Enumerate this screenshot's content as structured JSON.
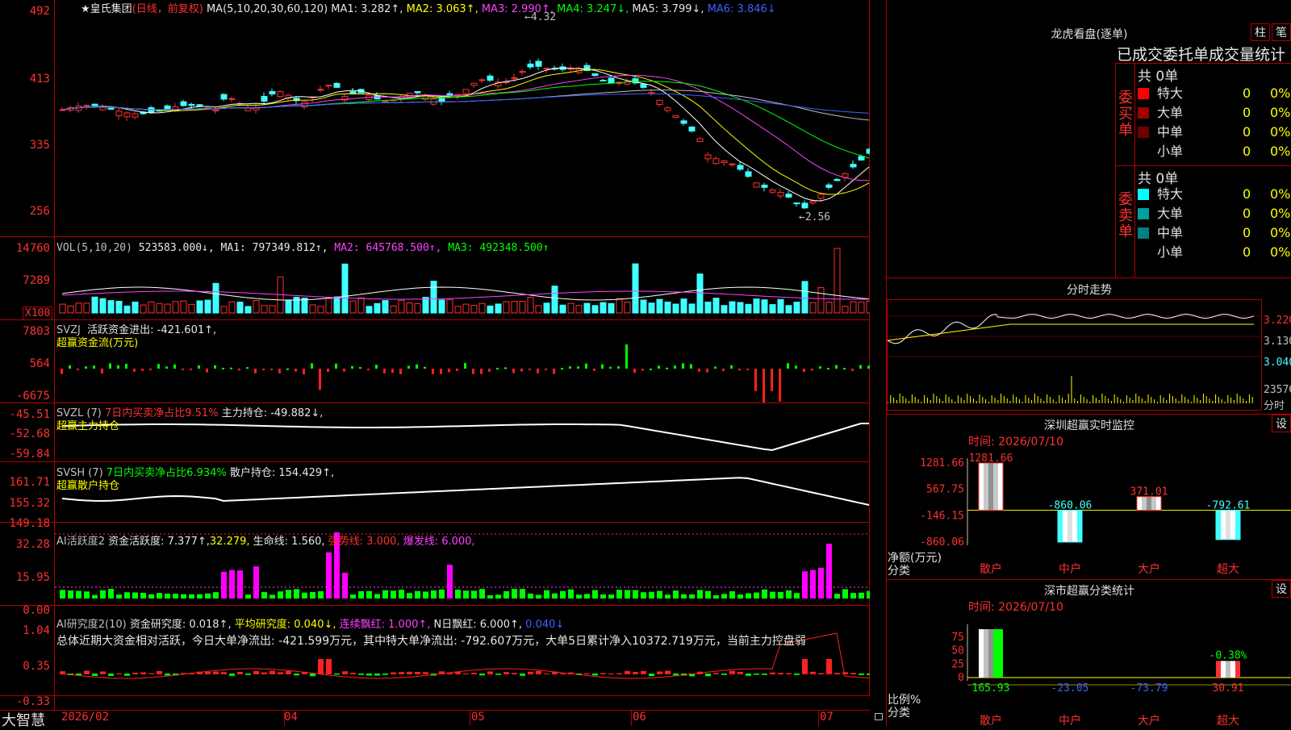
{
  "main": {
    "header": {
      "star": "★",
      "stock_name": "皇氏集团",
      "period": "(日线，前复权)",
      "ma_label": "MA(5,10,20,30,60,120)",
      "ma1": "MA1: 3.282↑,",
      "ma2": "MA2: 3.063↑,",
      "ma3": "MA3: 2.990↑,",
      "ma4": "MA4: 3.247↓,",
      "ma5": "MA5: 3.799↓,",
      "ma6": "MA6: 3.846↓"
    },
    "axis": [
      "492",
      "413",
      "335",
      "256"
    ],
    "high_label": "←4.32",
    "low_label": "←2.56"
  },
  "vol": {
    "header": {
      "name": "VOL(5,10,20)",
      "value": "523583.000↓,",
      "ma1": "MA1: 797349.812↑,",
      "ma2": "MA2: 645768.500↑,",
      "ma3": "MA3: 492348.500↑"
    },
    "axis": [
      "14760",
      "7289"
    ],
    "unit": "X100"
  },
  "svzj": {
    "header": {
      "name": "SVZJ",
      "line1": "活跃资金进出: -421.601↑,",
      "line2": "超赢资金流(万元)"
    },
    "axis": [
      "7803",
      "564",
      "-6675"
    ]
  },
  "svzl": {
    "header": {
      "name": "SVZL (7)",
      "ratio": "7日内买卖净占比9.51%",
      "value": "主力持仓: -49.882↓,",
      "line2": "超赢主力持仓"
    },
    "axis": [
      "-45.51",
      "-52.68",
      "-59.84"
    ]
  },
  "svsh": {
    "header": {
      "name": "SVSH (7)",
      "ratio": "7日内买卖净占比6.934%",
      "value": "散户持仓: 154.429↑,",
      "line2": "超赢散户持仓"
    },
    "axis": [
      "161.71",
      "155.32",
      "149.18"
    ]
  },
  "ai_active": {
    "header": {
      "name": "AI活跃度2",
      "a": "资金活跃度: 7.377↑,",
      "b": "32.279,",
      "c": "生命线: 1.560,",
      "d": "强势线: 3.000,",
      "e": "爆发线: 6.000,"
    },
    "axis": [
      "32.28",
      "15.95",
      "0.00"
    ]
  },
  "ai_research": {
    "header": {
      "name": "AI研究度2(10)",
      "a": "资金研究度: 0.018↑,",
      "b": "平均研究度: 0.040↓,",
      "c": "连续飘红: 1.000↑,",
      "d": "N日飘红: 6.000↑,",
      "e": "0.040↓"
    },
    "summary": "总体近期大资金相对活跃，今日大单净流出: -421.599万元，其中特大单净流出: -792.607万元，大单5日累计净入10372.719万元，当前主力控盘弱",
    "axis": [
      "1.04",
      "0.35",
      "-0.33"
    ]
  },
  "bottom": {
    "logo": "大智慧",
    "dates": [
      "2026/02",
      "04",
      "05",
      "06",
      "07"
    ]
  },
  "right": {
    "lhkp": {
      "title": "龙虎看盘(逐单)",
      "btn1": "柱",
      "btn2": "笔",
      "subtitle": "已成交委托单成交量统计"
    },
    "buy": {
      "label": "委买单",
      "total": "共 0单",
      "rows": [
        {
          "name": "特大",
          "count": "0",
          "pct": "0%",
          "color": "#ff0000"
        },
        {
          "name": "大单",
          "count": "0",
          "pct": "0%",
          "color": "#a00000"
        },
        {
          "name": "中单",
          "count": "0",
          "pct": "0%",
          "color": "#700000"
        },
        {
          "name": "小单",
          "count": "0",
          "pct": "0%",
          "color": "#000000"
        }
      ]
    },
    "sell": {
      "label": "委卖单",
      "total": "共 0单",
      "rows": [
        {
          "name": "特大",
          "count": "0",
          "pct": "0%",
          "color": "#00ffff"
        },
        {
          "name": "大单",
          "count": "0",
          "pct": "0%",
          "color": "#00a0a0"
        },
        {
          "name": "中单",
          "count": "0",
          "pct": "0%",
          "color": "#008080"
        },
        {
          "name": "小单",
          "count": "0",
          "pct": "0%",
          "color": "#000000"
        }
      ]
    },
    "fenshi": {
      "title": "分时走势",
      "axis": [
        "3.220",
        "3.130",
        "3.040"
      ],
      "vol_label": "23576",
      "vol_unit": "分时"
    },
    "monitor": {
      "title": "深圳超赢实时监控",
      "btn": "设",
      "time": "时间: 2026/07/10",
      "axis": [
        "1281.66",
        "567.75",
        "-146.15",
        "-860.06"
      ],
      "yunit": "净额(万元)",
      "xunit": "分类",
      "categories": [
        "散户",
        "中户",
        "大户",
        "超大"
      ],
      "values": [
        1281.66,
        -860.06,
        371.01,
        -792.61
      ],
      "value_labels": [
        "1281.66",
        "-860.06",
        "371.01",
        "-792.61"
      ]
    },
    "classify": {
      "title": "深市超赢分类统计",
      "btn": "设",
      "time": "时间: 2026/07/10",
      "axis": [
        "75",
        "50",
        "25",
        "0"
      ],
      "yunit": "比例%",
      "xunit": "分类",
      "categories": [
        "散户",
        "中户",
        "大户",
        "超大"
      ],
      "values": [
        165.93,
        -23.05,
        -73.79,
        30.91
      ],
      "value_labels": [
        "165.93",
        "-23.05",
        "-73.79",
        "30.91"
      ],
      "extra_label": "-0.38%"
    }
  }
}
